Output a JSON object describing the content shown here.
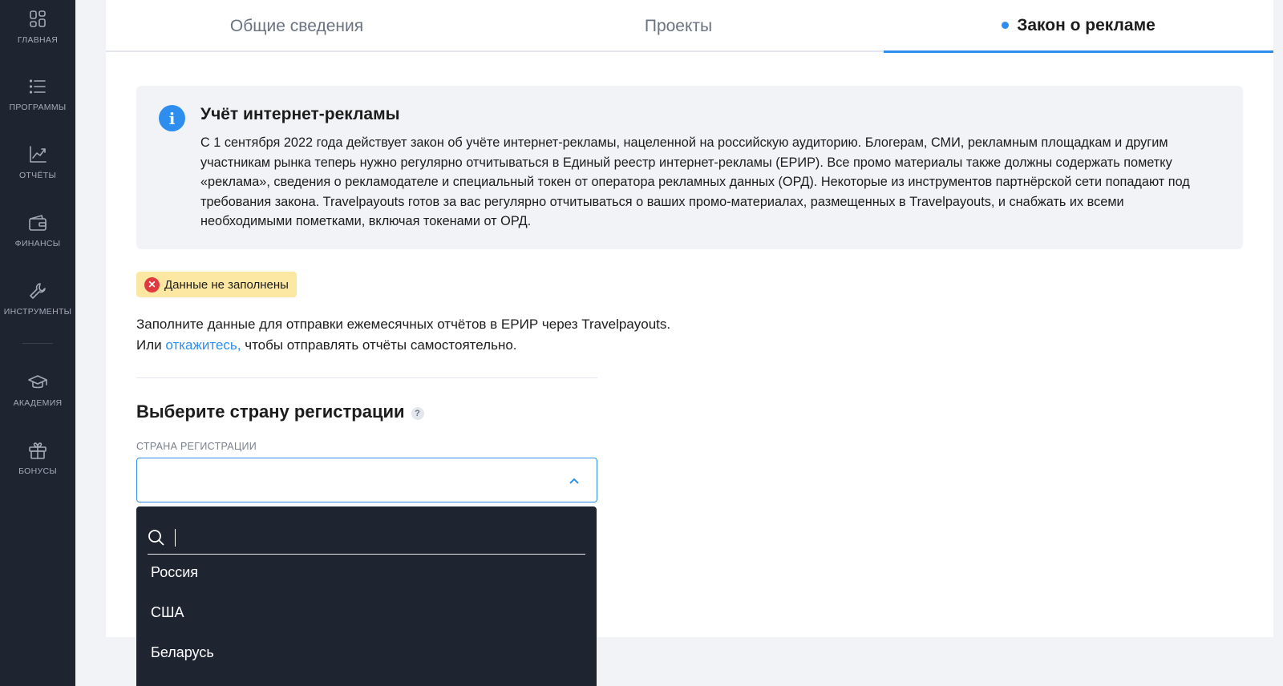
{
  "sidebar": {
    "items": [
      {
        "label": "Главная",
        "icon": "dashboard-icon"
      },
      {
        "label": "Программы",
        "icon": "list-icon"
      },
      {
        "label": "Отчёты",
        "icon": "chart-icon"
      },
      {
        "label": "Финансы",
        "icon": "wallet-icon"
      },
      {
        "label": "Инструменты",
        "icon": "wrench-icon"
      },
      {
        "label": "Академия",
        "icon": "graduation-cap-icon"
      },
      {
        "label": "Бонусы",
        "icon": "gift-icon"
      }
    ]
  },
  "tabs": [
    {
      "label": "Общие сведения",
      "active": false
    },
    {
      "label": "Проекты",
      "active": false
    },
    {
      "label": "Закон о рекламе",
      "active": true
    }
  ],
  "info": {
    "title": "Учёт интернет-рекламы",
    "text": "С 1 сентября 2022 года действует закон об учёте интернет-рекламы, нацеленной на российскую аудиторию. Блогерам, СМИ, рекламным площадкам и другим участникам рынка теперь нужно регулярно отчитываться в Единый реестр интернет-рекламы (ЕРИР). Все промо материалы также должны содержать пометку «реклама», сведения о рекламодателе и специальный токен от оператора рекламных данных (ОРД). Некоторые из инструментов партнёрской сети попадают под требования закона. Travelpayouts готов за вас регулярно отчитываться о ваших промо-материалах, размещенных в Travelpayouts, и снабжать их всеми необходимыми пометками, включая токенами от ОРД."
  },
  "status": {
    "label": "Данные не заполнены",
    "color": "#fde8a3"
  },
  "description": {
    "line1": "Заполните данные для отправки ежемесячных отчётов в ЕРИР через Travelpayouts.",
    "line2_prefix": "Или ",
    "line2_link": "откажитесь,",
    "line2_suffix": " чтобы отправлять отчёты самостоятельно."
  },
  "country_section": {
    "title": "Выберите страну регистрации",
    "help": "?",
    "field_label": "Страна регистрации",
    "selected_value": "",
    "search_value": "",
    "options": [
      "Россия",
      "США",
      "Беларусь"
    ]
  },
  "colors": {
    "accent": "#2e8ef0",
    "sidebar_bg": "#1f2431",
    "error": "#e0393e"
  }
}
